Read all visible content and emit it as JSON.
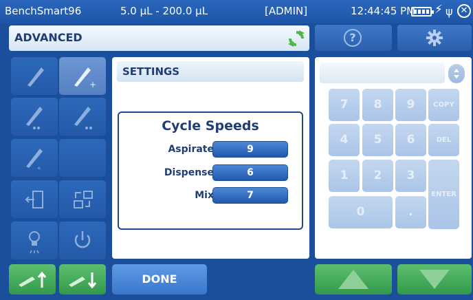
{
  "status": {
    "app_name": "BenchSmart96",
    "volume_range": "5.0 µL - 200.0 µL",
    "user": "[ADMIN]",
    "time": "12:44:45 PM"
  },
  "header": {
    "title": "ADVANCED",
    "help_label": "?"
  },
  "settings": {
    "header": "SETTINGS",
    "cycle_title": "Cycle Speeds",
    "rows": [
      {
        "label": "Aspirate",
        "value": "9"
      },
      {
        "label": "Dispense",
        "value": "6"
      },
      {
        "label": "Mix",
        "value": "7"
      }
    ]
  },
  "keypad": {
    "k7": "7",
    "k8": "8",
    "k9": "9",
    "copy": "COPY",
    "k4": "4",
    "k5": "5",
    "k6": "6",
    "del": "DEL",
    "k1": "1",
    "k2": "2",
    "k3": "3",
    "enter": "ENTER",
    "k0": "0",
    "dot": "."
  },
  "footer": {
    "done_label": "DONE"
  },
  "colors": {
    "background": "#1b4f9c",
    "green": "#34994b",
    "accent": "#3a77cc"
  }
}
